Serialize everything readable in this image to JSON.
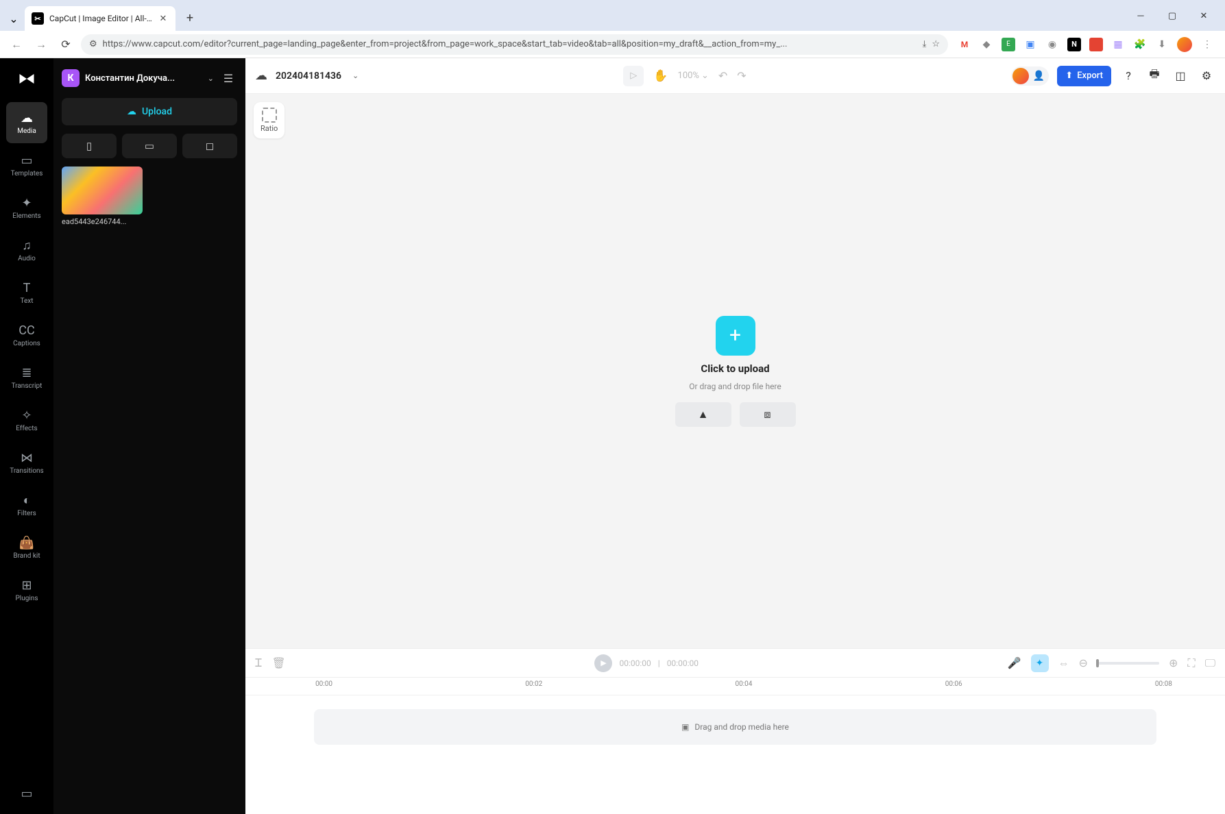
{
  "browser": {
    "tab_title": "CapCut | Image Editor | All-In...",
    "url": "https://www.capcut.com/editor?current_page=landing_page&enter_from=project&from_page=work_space&start_tab=video&tab=all&position=my_draft&__action_from=my_..."
  },
  "rail": [
    {
      "icon": "☁",
      "label": "Media",
      "active": true
    },
    {
      "icon": "▭",
      "label": "Templates"
    },
    {
      "icon": "✦",
      "label": "Elements"
    },
    {
      "icon": "♫",
      "label": "Audio"
    },
    {
      "icon": "T",
      "label": "Text"
    },
    {
      "icon": "CC",
      "label": "Captions"
    },
    {
      "icon": "≣",
      "label": "Transcript"
    },
    {
      "icon": "✧",
      "label": "Effects"
    },
    {
      "icon": "⋈",
      "label": "Transitions"
    },
    {
      "icon": "◐",
      "label": "Filters"
    },
    {
      "icon": "👜",
      "label": "Brand kit"
    },
    {
      "icon": "⊞",
      "label": "Plugins"
    }
  ],
  "panel": {
    "user_initial": "К",
    "user_name": "Константин Докуча...",
    "upload_label": "Upload",
    "thumb_label": "ead5443e246744..."
  },
  "topbar": {
    "project_title": "202404181436",
    "zoom": "100%",
    "export_label": "Export"
  },
  "canvas": {
    "ratio_label": "Ratio",
    "upload_title": "Click to upload",
    "upload_sub": "Or drag and drop file here"
  },
  "ctrl": {
    "time_current": "00:00:00",
    "time_total": "00:00:00"
  },
  "timeline": {
    "ticks": [
      "00:00",
      "00:02",
      "00:04",
      "00:06",
      "00:08"
    ],
    "drop_label": "Drag and drop media here"
  }
}
